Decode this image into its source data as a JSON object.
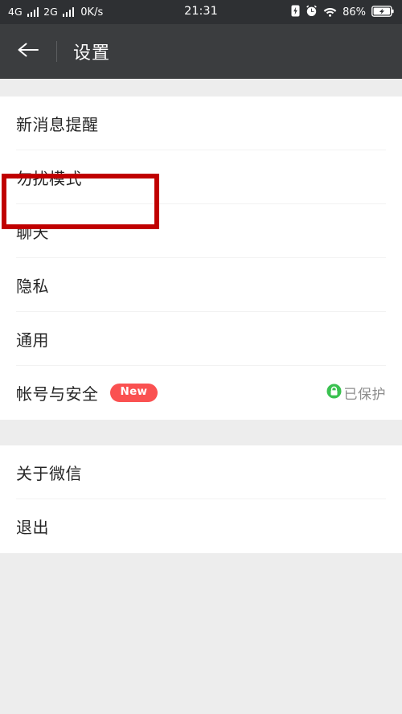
{
  "status_bar": {
    "network_1": "4G",
    "network_2": "2G",
    "data_speed": "0K/s",
    "time": "21:31",
    "battery_percent": "86%",
    "icons": {
      "signal_1": "signal-bars-icon",
      "signal_2": "signal-bars-icon",
      "charge": "charging-battery-icon",
      "alarm": "alarm-clock-icon",
      "wifi": "wifi-icon",
      "battery": "battery-charging-icon"
    }
  },
  "header": {
    "back_icon": "back-arrow-icon",
    "title": "设置"
  },
  "settings": {
    "group_1": [
      {
        "label": "新消息提醒",
        "badge": "",
        "value": "",
        "highlighted": true
      },
      {
        "label": "勿扰模式",
        "badge": "",
        "value": "",
        "highlighted": false
      },
      {
        "label": "聊天",
        "badge": "",
        "value": "",
        "highlighted": false
      },
      {
        "label": "隐私",
        "badge": "",
        "value": "",
        "highlighted": false
      },
      {
        "label": "通用",
        "badge": "",
        "value": "",
        "highlighted": false
      },
      {
        "label": "帐号与安全",
        "badge": "New",
        "value": "已保护",
        "highlighted": false
      }
    ],
    "group_2": [
      {
        "label": "关于微信",
        "badge": "",
        "value": ""
      },
      {
        "label": "退出",
        "badge": "",
        "value": ""
      }
    ]
  },
  "colors": {
    "status_bar_bg": "#2e3033",
    "header_bg": "#3b3d3f",
    "page_bg": "#ededed",
    "card_bg": "#ffffff",
    "badge_red": "#fa5151",
    "annotation_red": "#c00000",
    "protected_green": "#3ac150",
    "text_primary": "#262626",
    "text_secondary": "#8d8d8d"
  }
}
